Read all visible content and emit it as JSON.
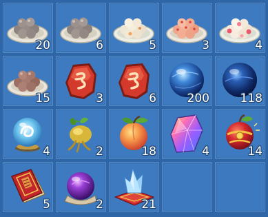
{
  "inventory": {
    "slots": [
      {
        "icon": "grey-dumplings-plate-icon",
        "count": "20"
      },
      {
        "icon": "grey-dumplings-plate-icon",
        "count": "6"
      },
      {
        "icon": "white-dumplings-plate-icon",
        "count": "5"
      },
      {
        "icon": "pink-dumplings-plate-icon",
        "count": "3"
      },
      {
        "icon": "flower-dumplings-plate-icon",
        "count": "4"
      },
      {
        "icon": "brown-dumplings-plate-icon",
        "count": "15"
      },
      {
        "icon": "red-rune-stone-icon",
        "count": "3"
      },
      {
        "icon": "red-rune-stone-icon",
        "count": "6"
      },
      {
        "icon": "blue-orb-icon",
        "count": "200"
      },
      {
        "icon": "dark-blue-orb-icon",
        "count": "118"
      },
      {
        "icon": "swirl-crystal-ball-icon",
        "count": "4"
      },
      {
        "icon": "golden-root-icon",
        "count": "2"
      },
      {
        "icon": "peach-icon",
        "count": "18"
      },
      {
        "icon": "rainbow-gem-icon",
        "count": "4"
      },
      {
        "icon": "golden-apple-icon",
        "count": "14"
      },
      {
        "icon": "red-book-icon",
        "count": "5"
      },
      {
        "icon": "purple-orb-icon",
        "count": "2"
      },
      {
        "icon": "crystal-on-cushion-icon",
        "count": "21"
      },
      {
        "icon": "empty-slot",
        "count": ""
      },
      {
        "icon": "empty-slot",
        "count": ""
      }
    ]
  },
  "colors": {
    "background": "#2f66a8",
    "slot": "#3d7ac0",
    "slot_border": "#5c93d3"
  }
}
